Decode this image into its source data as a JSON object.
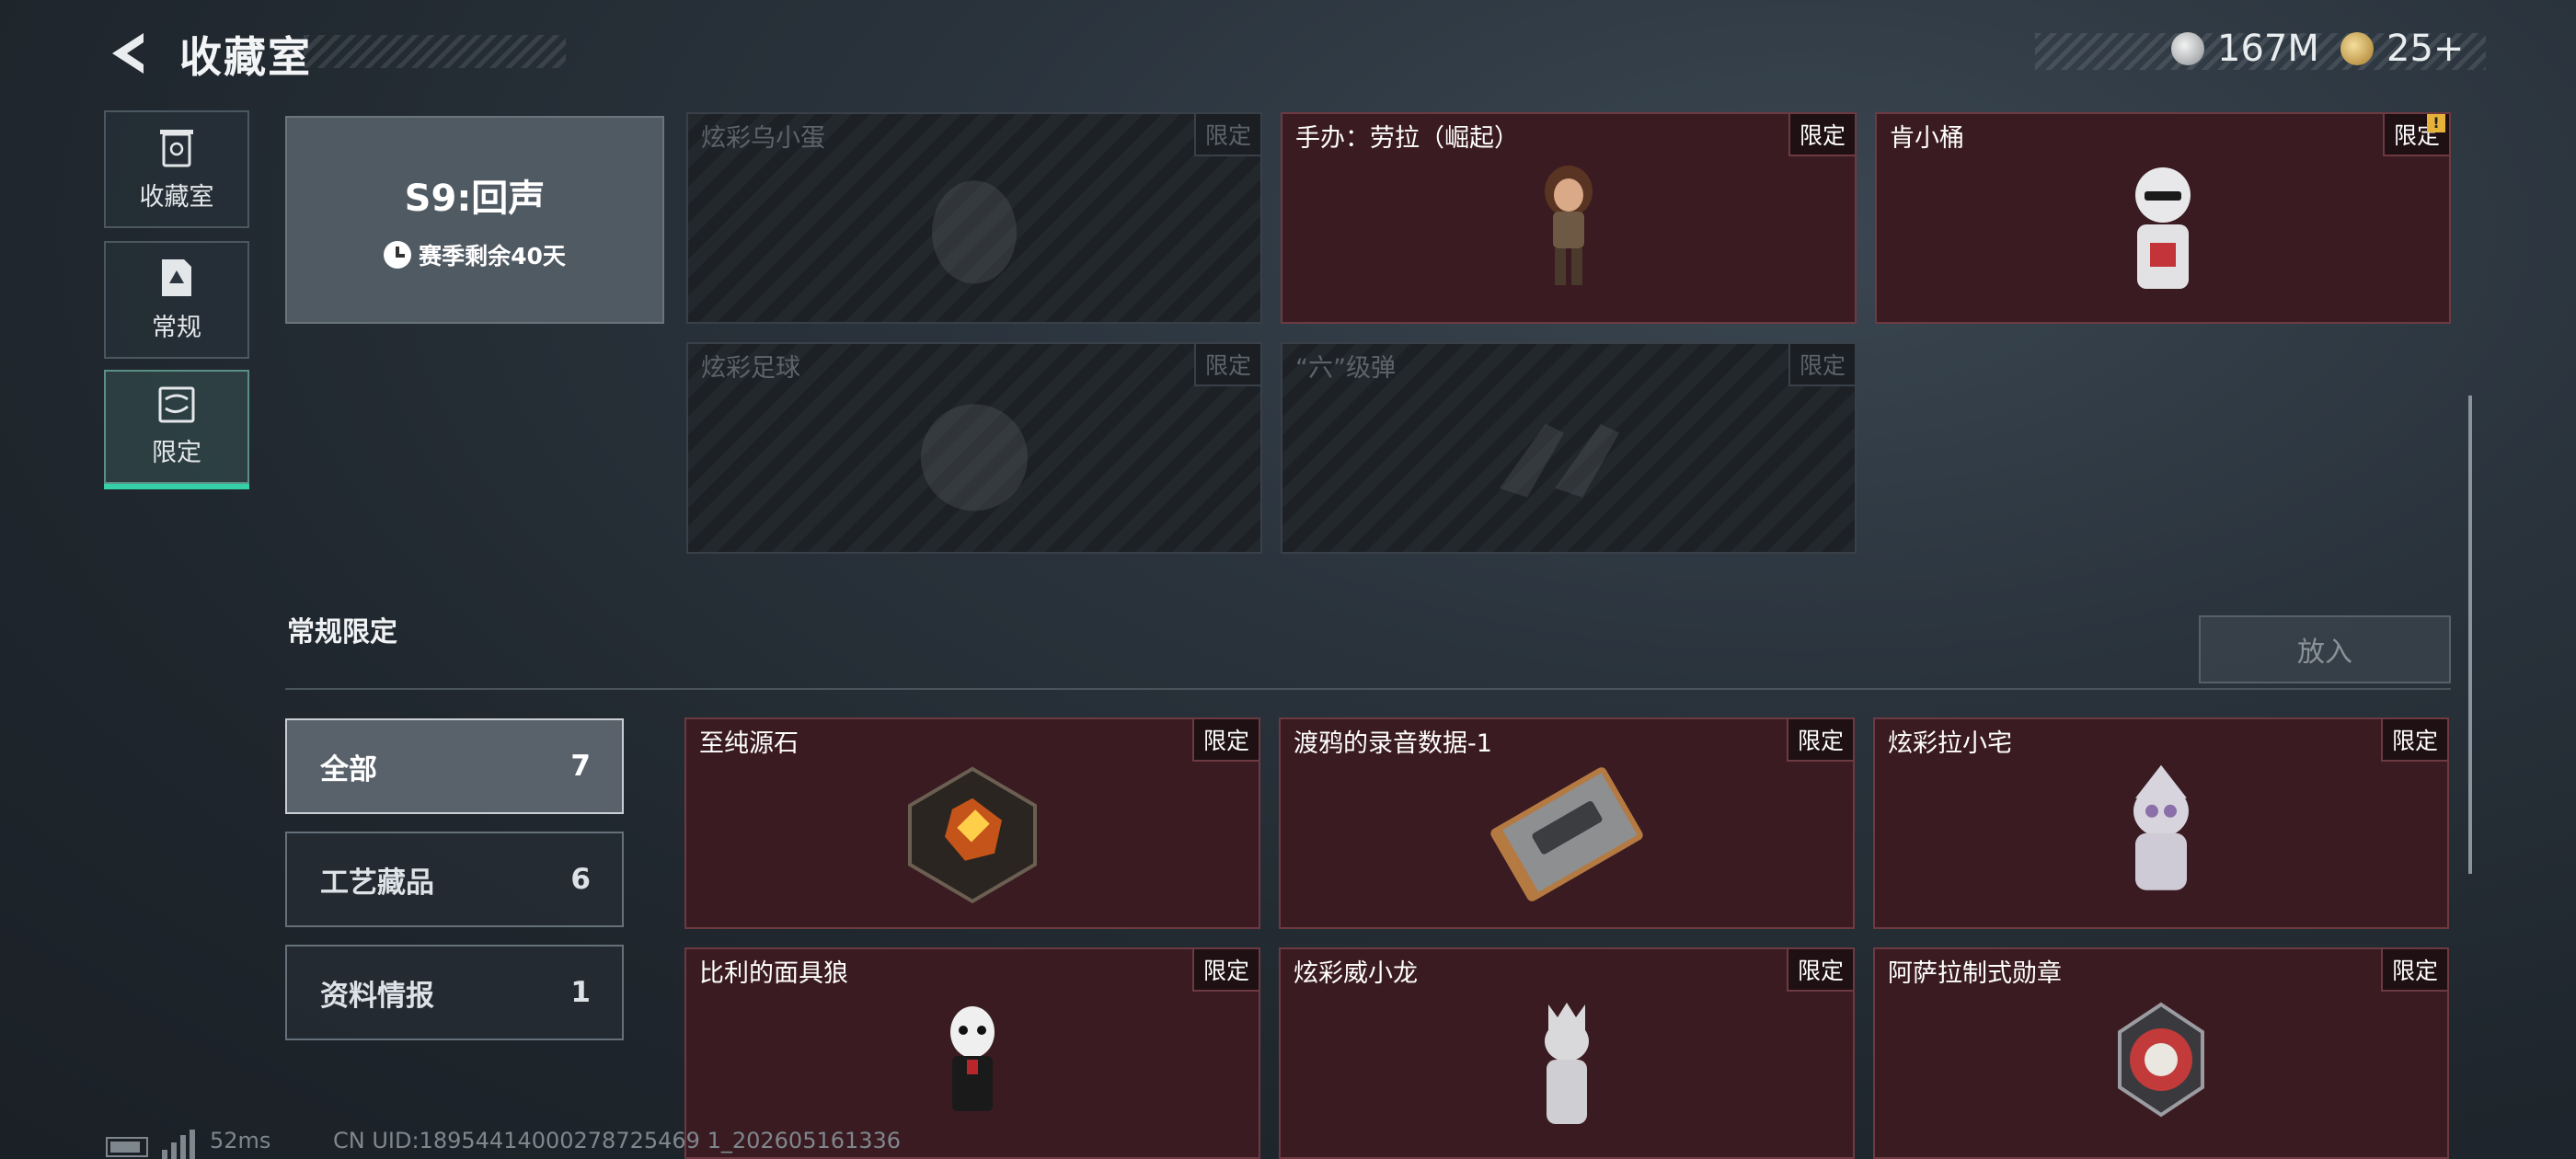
{
  "header": {
    "title": "收藏室",
    "currency_1": "167M",
    "currency_2": "25+"
  },
  "side_tabs": [
    {
      "label": "收藏室",
      "icon": "trash-bin-icon"
    },
    {
      "label": "常规",
      "icon": "document-icon"
    },
    {
      "label": "限定",
      "icon": "map-icon"
    }
  ],
  "season": {
    "name": "S9:回声",
    "remaining": "赛季剩余40天"
  },
  "season_items": [
    {
      "name": "炫彩乌小蛋",
      "tag": "限定",
      "state": "locked"
    },
    {
      "name": "手办：劳拉（崛起）",
      "tag": "限定",
      "state": "owned"
    },
    {
      "name": "肯小桶",
      "tag": "限定",
      "state": "owned"
    },
    {
      "name": "炫彩足球",
      "tag": "限定",
      "state": "locked"
    },
    {
      "name": "“六”级弹",
      "tag": "限定",
      "state": "locked"
    }
  ],
  "regular_section": {
    "title": "常规限定",
    "put_button": "放入",
    "filters": [
      {
        "label": "全部",
        "count": "7"
      },
      {
        "label": "工艺藏品",
        "count": "6"
      },
      {
        "label": "资料情报",
        "count": "1"
      }
    ],
    "items": [
      {
        "name": "至纯源石",
        "tag": "限定"
      },
      {
        "name": "渡鸦的录音数据-1",
        "tag": "限定"
      },
      {
        "name": "炫彩拉小宅",
        "tag": "限定"
      },
      {
        "name": "比利的面具狼",
        "tag": "限定"
      },
      {
        "name": "炫彩威小龙",
        "tag": "限定"
      },
      {
        "name": "阿萨拉制式勋章",
        "tag": "限定"
      }
    ]
  },
  "footer": {
    "ping": "52ms",
    "uid": "CN UID:18954414000278725469 1_202605161336"
  }
}
